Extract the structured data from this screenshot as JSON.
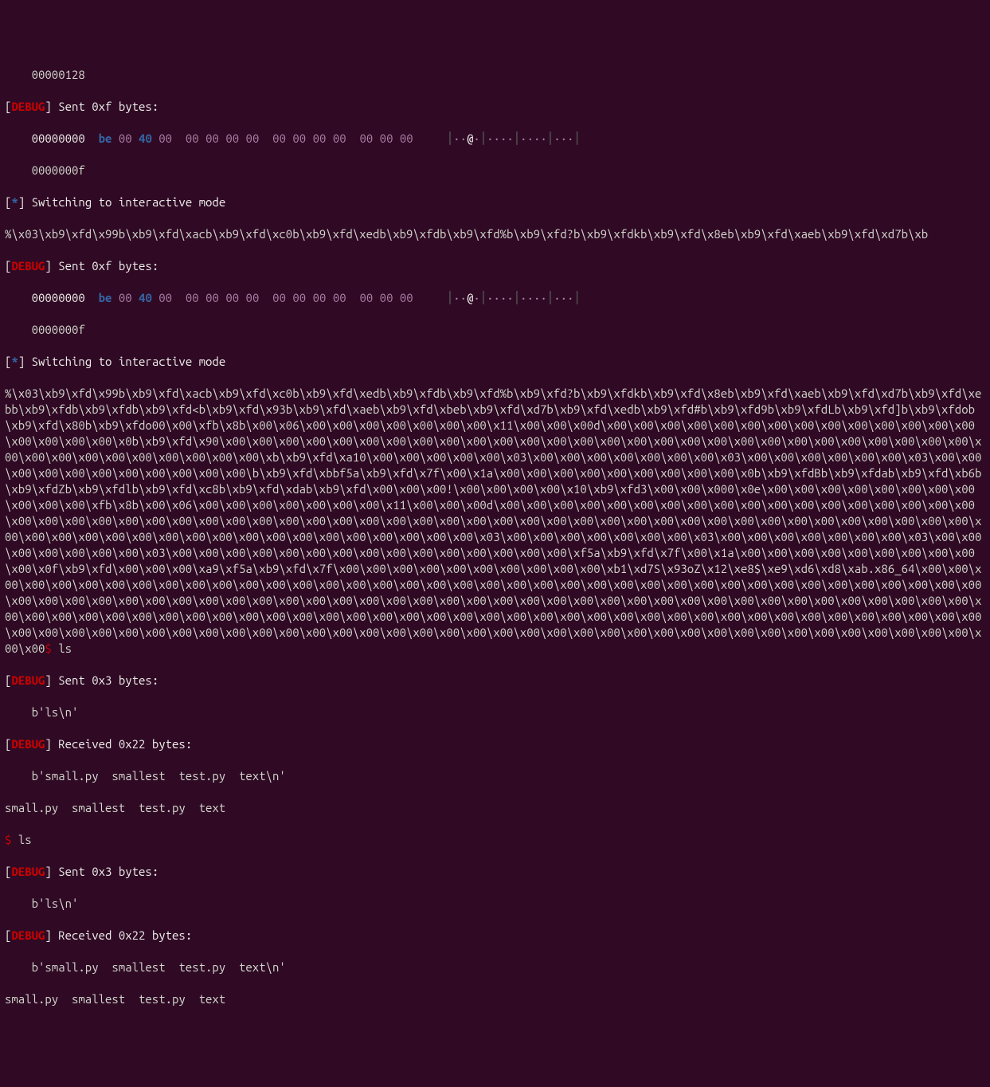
{
  "lines": {
    "l1_indent": "    00000128",
    "debug_open": "[",
    "debug_tag": "DEBUG",
    "debug_close_sent0xf": "] Sent 0xf bytes:",
    "hex_addr": "    00000000  ",
    "hex_be": "be",
    "hex_00": "00",
    "hex_40": "40",
    "hex_sep": "│",
    "hex_ascii1": "··",
    "hex_ascii_at": "@",
    "hex_ascii2": "·",
    "hex_ascii_dots4": "····",
    "hex_ascii_dots3": "···",
    "after_hex": "    0000000f",
    "star": "*",
    "switching": "] Switching to interactive mode",
    "leak1": "%\\x03\\xb9\\xfd\\x99b\\xb9\\xfd\\xacb\\xb9\\xfd\\xc0b\\xb9\\xfd\\xedb\\xb9\\xfdb\\xb9\\xfd%b\\xb9\\xfd?b\\xb9\\xfdkb\\xb9\\xfd\\x8eb\\xb9\\xfd\\xaeb\\xb9\\xfd\\xd7b\\xb",
    "leak2": "%\\x03\\xb9\\xfd\\x99b\\xb9\\xfd\\xacb\\xb9\\xfd\\xc0b\\xb9\\xfd\\xedb\\xb9\\xfdb\\xb9\\xfd%b\\xb9\\xfd?b\\xb9\\xfdkb\\xb9\\xfd\\x8eb\\xb9\\xfd\\xaeb\\xb9\\xfd\\xd7b\\xb9\\xfd\\xebb\\xb9\\xfdb\\xb9\\xfdb\\xb9\\xfd<b\\xb9\\xfd\\x93b\\xb9\\xfd\\xaeb\\xb9\\xfd\\xbeb\\xb9\\xfd\\xd7b\\xb9\\xfd\\xedb\\xb9\\xfd#b\\xb9\\xfd9b\\xb9\\xfdLb\\xb9\\xfd]b\\xb9\\xfdob\\xb9\\xfd\\x80b\\xb9\\xfdo00\\x00\\xfb\\x8b\\x00\\x06\\x00\\x00\\x00\\x00\\x00\\x00\\x00\\x11\\x00\\x00\\x00d\\x00\\x00\\x00\\x00\\x00\\x00\\x00\\x00\\x00\\x00\\x00\\x00\\x00\\x00\\x00\\x00\\x00\\x00\\x0b\\xb9\\xfd\\x90\\x00\\x00\\x00\\x00\\x00\\x00\\x00\\x00\\x00\\x00\\x00\\x00\\x00\\x00\\x00\\x00\\x00\\x00\\x00\\x00\\x00\\x00\\x00\\x00\\x00\\x00\\x00\\x00\\x00\\x00\\x00\\x00\\x00\\x00\\x00\\x00\\x00\\x00\\xb\\xb9\\xfd\\xa10\\x00\\x00\\x00\\x00\\x00\\x03\\x00\\x00\\x00\\x00\\x00\\x00\\x00\\x03\\x00\\x00\\x00\\x00\\x00\\x00\\x03\\x00\\x00\\x00\\x00\\x00\\x00\\x00\\x00\\x00\\x00\\x00\\b\\xb9\\xfd\\xbbf5a\\xb9\\xfd\\x7f\\x00\\x1a\\x00\\x00\\x00\\x00\\x00\\x00\\x00\\x00\\x00\\x0b\\xb9\\xfdBb\\xb9\\xfdab\\xb9\\xfd\\xb6b\\xb9\\xfdZb\\xb9\\xfdlb\\xb9\\xfd\\xc8b\\xb9\\xfd\\xdab\\xb9\\xfd\\x00\\x00\\x00!\\x00\\x00\\x00\\x00\\x10\\xb9\\xfd3\\x00\\x00\\x000\\x0e\\x00\\x00\\x00\\x00\\x00\\x00\\x00\\x00\\x00\\x00\\x00\\xfb\\x8b\\x00\\x06\\x00\\x00\\x00\\x00\\x00\\x00\\x00\\x11\\x00\\x00\\x00d\\x00\\x00\\x00\\x00\\x00\\x00\\x00\\x00\\x00\\x00\\x00\\x00\\x00\\x00\\x00\\x00\\x00\\x00\\x00\\x00\\x00\\x00\\x00\\x00\\x00\\x00\\x00\\x00\\x00\\x00\\x00\\x00\\x00\\x00\\x00\\x00\\x00\\x00\\x00\\x00\\x00\\x00\\x00\\x00\\x00\\x00\\x00\\x00\\x00\\x00\\x00\\x00\\x00\\x00\\x00\\x00\\x00\\x00\\x00\\x00\\x00\\x00\\x00\\x00\\x00\\x00\\x00\\x00\\x00\\x00\\x00\\x00\\x03\\x00\\x00\\x00\\x00\\x00\\x00\\x00\\x03\\x00\\x00\\x00\\x00\\x00\\x00\\x00\\x03\\x00\\x00\\x00\\x00\\x00\\x00\\x00\\x03\\x00\\x00\\x00\\x00\\x00\\x00\\x00\\x00\\x00\\x00\\x00\\x00\\x00\\x00\\x00\\xf5a\\xb9\\xfd\\x7f\\x00\\x1a\\x00\\x00\\x00\\x00\\x00\\x00\\x00\\x00\\x00\\x00\\x0f\\xb9\\xfd\\x00\\x00\\x00\\xa9\\xf5a\\xb9\\xfd\\x7f\\x00\\x00\\x00\\x00\\x00\\x00\\x00\\x00\\x00\\x00\\xb1\\xd7S\\x93oZ\\x12\\xe8$\\xe9\\xd6\\xd8\\xab.x86_64\\x00\\x00\\x00\\x00\\x00\\x00\\x00\\x00\\x00\\x00\\x00\\x00\\x00\\x00\\x00\\x00\\x00\\x00\\x00\\x00\\x00\\x00\\x00\\x00\\x00\\x00\\x00\\x00\\x00\\x00\\x00\\x00\\x00\\x00\\x00\\x00\\x00\\x00\\x00\\x00\\x00\\x00\\x00\\x00\\x00\\x00\\x00\\x00\\x00\\x00\\x00\\x00\\x00\\x00\\x00\\x00\\x00\\x00\\x00\\x00\\x00\\x00\\x00\\x00\\x00\\x00\\x00\\x00\\x00\\x00\\x00\\x00\\x00\\x00\\x00\\x00\\x00\\x00\\x00\\x00\\x00\\x00\\x00\\x00\\x00\\x00\\x00\\x00\\x00\\x00\\x00\\x00\\x00\\x00\\x00\\x00\\x00\\x00\\x00\\x00\\x00\\x00\\x00\\x00\\x00\\x00\\x00\\x00\\x00\\x00\\x00\\x00\\x00\\x00\\x00\\x00\\x00\\x00\\x00\\x00\\x00\\x00\\x00\\x00\\x00\\x00\\x00\\x00\\x00\\x00\\x00\\x00\\x00\\x00\\x00\\x00\\x00\\x00\\x00\\x00\\x00\\x00\\x00\\x00\\x00\\x00\\x00\\x00\\x00\\x00",
    "dollar": "$",
    "ls": " ls",
    "sent_0x3": "] Sent 0x3 bytes:",
    "bls": "    b'ls\\n'",
    "recv_0x22": "] Received 0x22 bytes:",
    "bsmall": "    b'small.py  smallest  test.py  text\\n'",
    "files": "small.py  smallest  test.py  text"
  }
}
